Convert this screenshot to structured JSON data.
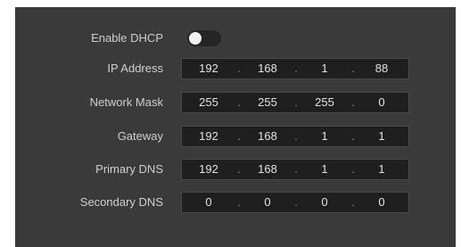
{
  "dhcp": {
    "label": "Enable DHCP",
    "enabled": false
  },
  "fields": [
    {
      "label": "IP Address",
      "octets": [
        "192",
        "168",
        "1",
        "88"
      ]
    },
    {
      "label": "Network Mask",
      "octets": [
        "255",
        "255",
        "255",
        "0"
      ]
    },
    {
      "label": "Gateway",
      "octets": [
        "192",
        "168",
        "1",
        "1"
      ]
    },
    {
      "label": "Primary DNS",
      "octets": [
        "192",
        "168",
        "1",
        "1"
      ]
    },
    {
      "label": "Secondary DNS",
      "octets": [
        "0",
        "0",
        "0",
        "0"
      ]
    }
  ],
  "separator": "."
}
